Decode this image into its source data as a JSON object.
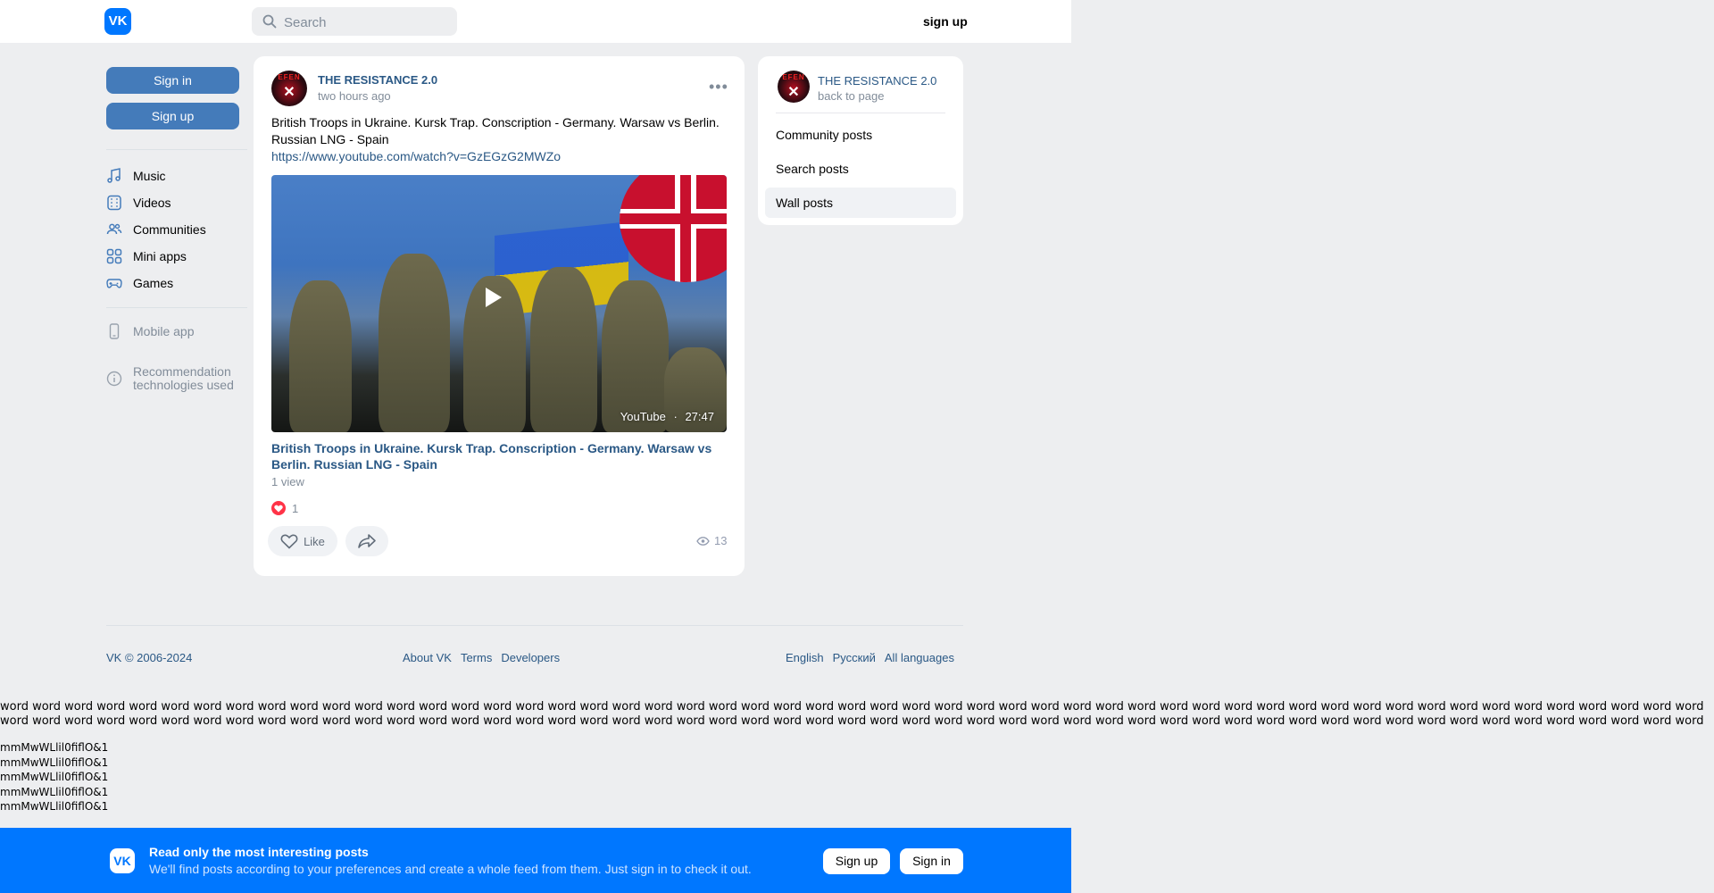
{
  "header": {
    "logo": "VK",
    "search_placeholder": "Search",
    "signup_link": "sign up"
  },
  "sidebar": {
    "signin_label": "Sign in",
    "signup_label": "Sign up",
    "items": [
      {
        "label": "Music",
        "icon": "music-icon"
      },
      {
        "label": "Videos",
        "icon": "video-icon"
      },
      {
        "label": "Communities",
        "icon": "users-icon"
      },
      {
        "label": "Mini apps",
        "icon": "apps-icon"
      },
      {
        "label": "Games",
        "icon": "gamepad-icon"
      }
    ],
    "mobile_app": "Mobile app",
    "recommendation_line1": "Recommendation",
    "recommendation_line2": "technologies used"
  },
  "post": {
    "author": "THE RESISTANCE 2.0",
    "avatar_text": "EFEN",
    "time": "two hours ago",
    "text": "British Troops in Ukraine. Kursk Trap. Conscription - Germany. Warsaw vs Berlin. Russian LNG - Spain",
    "link": "https://www.youtube.com/watch?v=GzEGzG2MWZo",
    "video": {
      "source": "YouTube",
      "separator": "·",
      "duration": "27:47",
      "title": "British Troops in Ukraine. Kursk Trap. Conscription - Germany. Warsaw vs Berlin. Russian LNG - Spain",
      "views": "1 view"
    },
    "reactions_count": "1",
    "like_label": "Like",
    "views_count": "13"
  },
  "side_panel": {
    "author": "THE RESISTANCE 2.0",
    "back_label": "back to page",
    "items": [
      {
        "label": "Community posts"
      },
      {
        "label": "Search posts"
      },
      {
        "label": "Wall posts"
      }
    ]
  },
  "footer": {
    "copyright": "VK © 2006-2024",
    "links": [
      "About VK",
      "Terms",
      "Developers"
    ],
    "languages": [
      "English",
      "Русский",
      "All languages"
    ]
  },
  "test_text": {
    "word_line": "word word word word word word word word word word word word word word word word word word word word word word word word word word word word word word word word word word word word word word word word word word word word word word word word word word word word word word word word word word word word word word word word word word word word word word word word word word word word word word word word word word word word word word word word word word word word word word word word word word word word word word word word word word word word word word word",
    "mm_lines": [
      "mmMwWLlil0fiflO&1",
      "mmMwWLlil0fiflO&1",
      "mmMwWLlil0fiflO&1",
      "mmMwWLlil0fiflO&1",
      "mmMwWLlil0fiflO&1"
    ]
  },
  "banner": {
    "title": "Read only the most interesting posts",
    "subtitle": "We'll find posts according to your preferences and create a whole feed from them. Just sign in to check it out.",
    "signup_label": "Sign up",
    "signin_label": "Sign in"
  }
}
